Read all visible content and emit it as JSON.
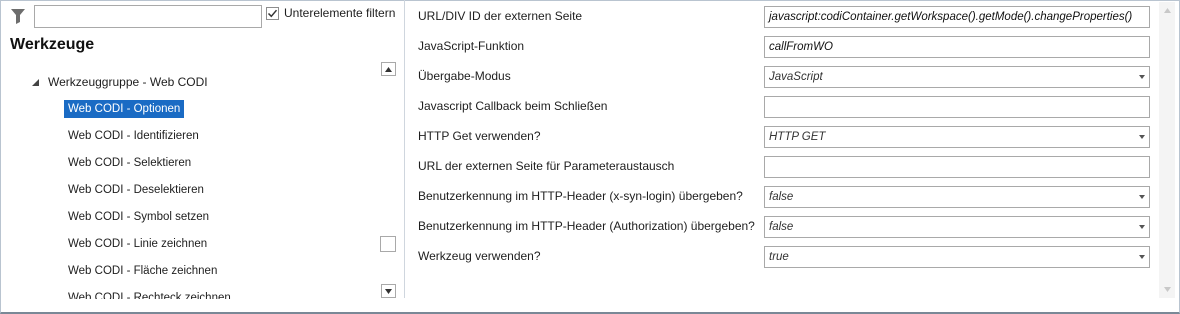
{
  "filter": {
    "icon": "funnel-icon",
    "input_value": "",
    "checkbox_label": "Unterelemente filtern",
    "checkbox_checked": true
  },
  "panel_title": "Werkzeuge",
  "tree": {
    "group_label": "Werkzeuggruppe - Web CODI",
    "items": [
      "Web CODI - Optionen",
      "Web CODI - Identifizieren",
      "Web CODI - Selektieren",
      "Web CODI - Deselektieren",
      "Web CODI - Symbol setzen",
      "Web CODI - Linie zeichnen",
      "Web CODI - Fläche zeichnen",
      "Web CODI - Rechteck zeichnen"
    ],
    "selected_index": 0
  },
  "properties": [
    {
      "label": "URL/DIV ID der externen Seite",
      "value": "javascript:codiContainer.getWorkspace().getMode().changeProperties()",
      "type": "text"
    },
    {
      "label": "JavaScript-Funktion",
      "value": "callFromWO",
      "type": "text"
    },
    {
      "label": "Übergabe-Modus",
      "value": "JavaScript",
      "type": "select"
    },
    {
      "label": "Javascript Callback beim Schließen",
      "value": "",
      "type": "text"
    },
    {
      "label": "HTTP Get verwenden?",
      "value": "HTTP GET",
      "type": "select"
    },
    {
      "label": "URL der externen Seite für Parameteraustausch",
      "value": "",
      "type": "text"
    },
    {
      "label": "Benutzerkennung im HTTP-Header (x-syn-login) übergeben?",
      "value": "false",
      "type": "select"
    },
    {
      "label": "Benutzerkennung im HTTP-Header (Authorization) übergeben?",
      "value": "false",
      "type": "select"
    },
    {
      "label": "Werkzeug verwenden?",
      "value": "true",
      "type": "select"
    }
  ],
  "colors": {
    "selection": "#1a6bc4",
    "border": "#a9a9a9"
  }
}
